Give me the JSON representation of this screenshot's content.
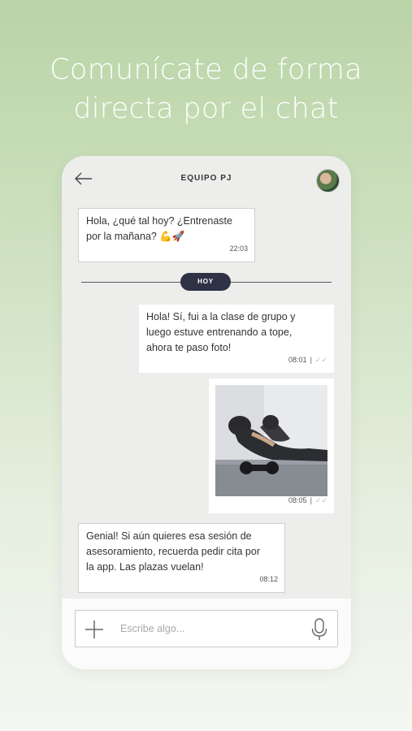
{
  "headline": {
    "line1": "Comunícate de forma",
    "line2": "directa por el chat"
  },
  "chat": {
    "title": "EQUIPO PJ",
    "day_label": "HOY",
    "messages": [
      {
        "direction": "incoming",
        "lines": [
          "Hola, ¿qué tal hoy? ¿Entrenaste",
          "por la mañana? 💪🚀"
        ],
        "time": "22:03"
      },
      {
        "direction": "outgoing",
        "lines": [
          "Hola! Sí, fui a la clase de grupo y",
          "luego estuve entrenando a tope,",
          "ahora te paso foto!"
        ],
        "time": "08:01",
        "separator": "|",
        "tick": "✓✓"
      },
      {
        "direction": "outgoing",
        "type": "photo",
        "photo_icon": "workout-photo",
        "time": "08:05",
        "separator": "|",
        "tick": "✓✓"
      },
      {
        "direction": "incoming",
        "lines": [
          "Genial! Si aún quieres esa sesión de",
          "asesoramiento, recuerda pedir cita por",
          "la app. Las plazas vuelan!"
        ],
        "time": "08:12"
      }
    ],
    "input": {
      "placeholder": "Escribe algo..."
    }
  },
  "icons": {
    "back": "back-arrow-icon",
    "avatar": "avatar",
    "attach": "plus-icon",
    "mic": "microphone-icon"
  },
  "colors": {
    "day_pill": "#2f3146",
    "chat_bg": "#ededec",
    "bubble": "#ffffff"
  }
}
